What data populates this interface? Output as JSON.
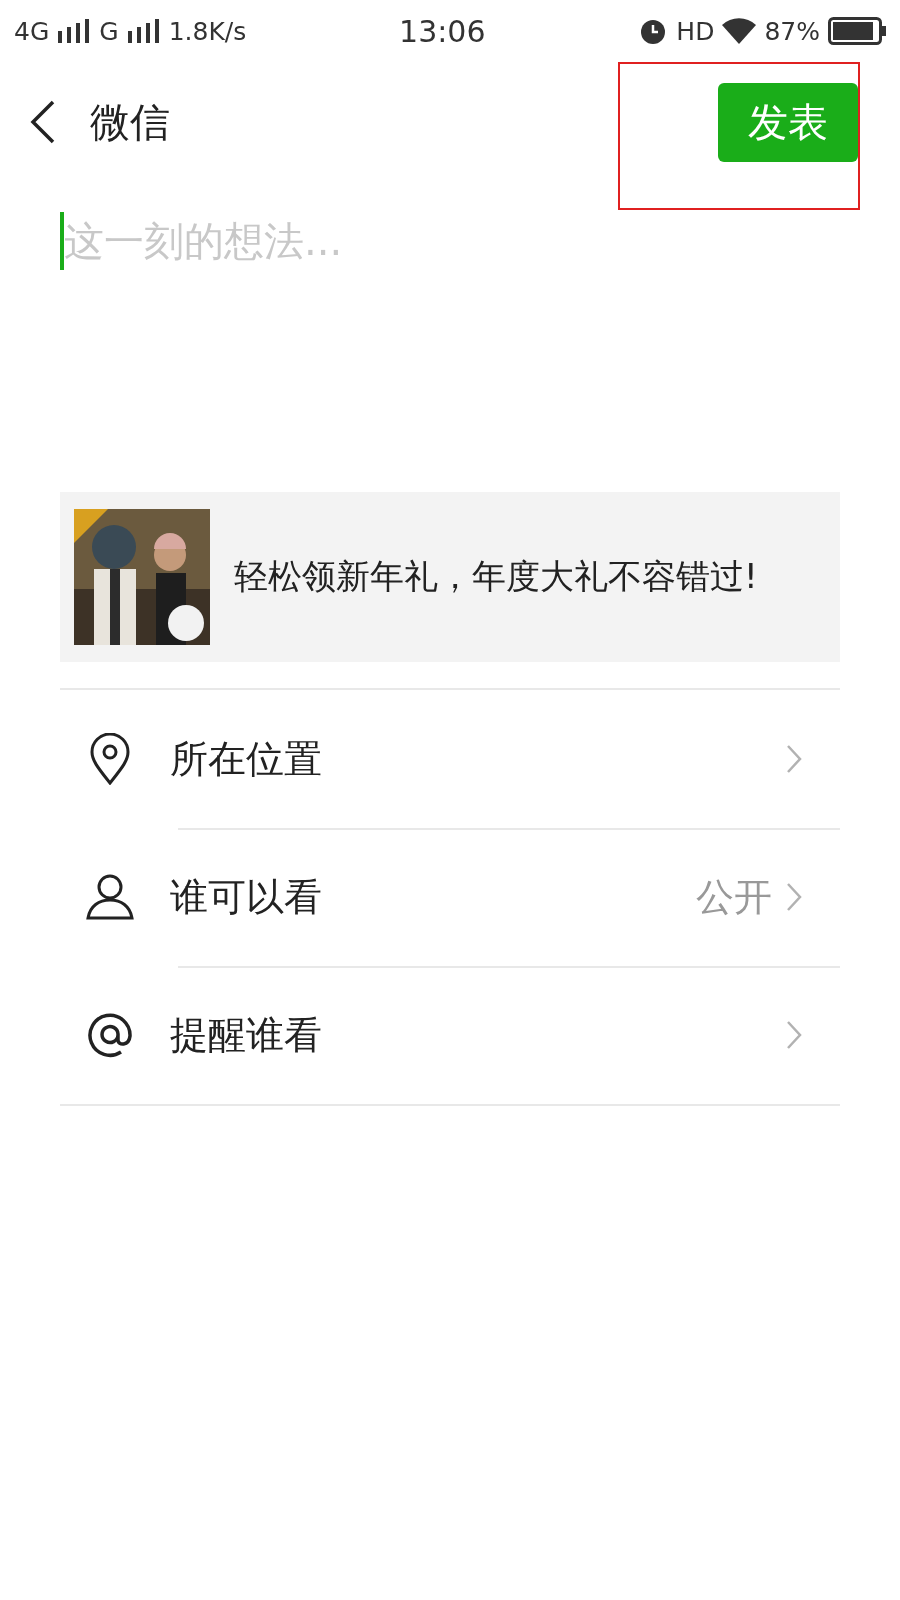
{
  "status_bar": {
    "network_1": "4G",
    "network_2": "G",
    "speed": "1.8K/s",
    "time": "13:06",
    "hd": "HD",
    "battery": "87%"
  },
  "header": {
    "title": "微信",
    "publish_button": {
      "label": "发表",
      "annotated": true
    }
  },
  "post": {
    "placeholder": "这一刻的想法..."
  },
  "link_card": {
    "kind": "picture",
    "text": "轻松领新年礼，年度大礼不容错过!"
  },
  "options": [
    {
      "kind": "location",
      "label": "所在位置"
    },
    {
      "kind": "visibility",
      "label": "谁可以看",
      "value": "公开"
    },
    {
      "kind": "mention",
      "label": "提醒谁看"
    }
  ]
}
